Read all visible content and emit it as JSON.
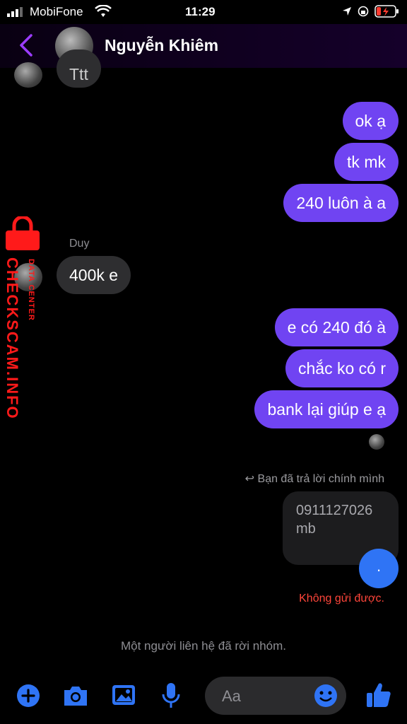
{
  "status_bar": {
    "carrier": "MobiFone",
    "time": "11:29"
  },
  "header": {
    "contact_name": "Nguyễn Khiêm"
  },
  "messages": {
    "top_partial": "Ttt",
    "out1": "ok ạ",
    "out2": "tk mk",
    "out3": "240 luôn à a",
    "sender": "Duy",
    "in1": "400k e",
    "out4": "e có 240 đó à",
    "out5": "chắc ko có r",
    "out6": "bank lại giúp e ạ"
  },
  "reply": {
    "label": "Bạn đã trả lời chính mình",
    "quoted_number": "0911127026",
    "quoted_suffix": "mb",
    "dot_text": ".",
    "error": "Không gửi được."
  },
  "system_message": "Một người liên hệ đã rời nhóm.",
  "composer": {
    "placeholder": "Aa"
  },
  "watermark": {
    "text": "CHECKSCAM.INFO",
    "subtext": "DATA CENTER"
  },
  "colors": {
    "outgoing": "#7044f2",
    "incoming": "#2e2e30",
    "accent_blue": "#2f74f5",
    "error": "#ff453a"
  }
}
